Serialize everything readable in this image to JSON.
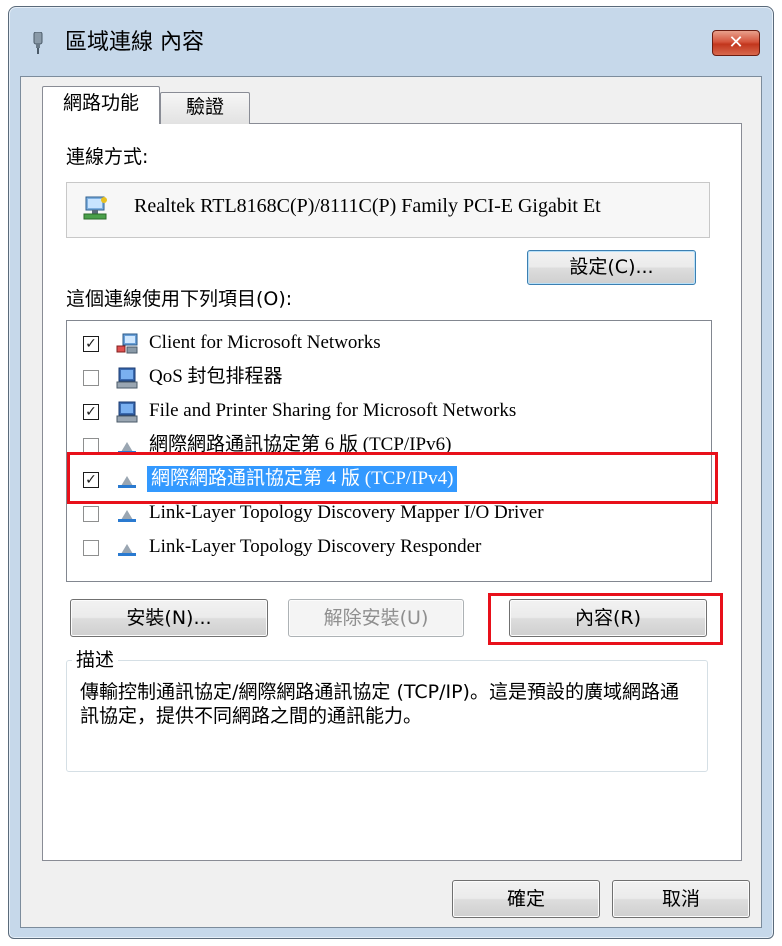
{
  "window": {
    "title": "區域連線 內容",
    "close_glyph": "✕",
    "close_color": "#c2361d"
  },
  "tabs": [
    {
      "label": "網路功能",
      "active": true
    },
    {
      "label": "驗證",
      "active": false
    }
  ],
  "connect_using": {
    "label": "連線方式:",
    "adapter": "Realtek RTL8168C(P)/8111C(P) Family PCI-E Gigabit Et",
    "configure_button": "設定(C)..."
  },
  "items": {
    "label": "這個連線使用下列項目(O):",
    "list": [
      {
        "label": "Client for Microsoft Networks",
        "checked": true,
        "icon": "network-client-icon"
      },
      {
        "label": "QoS 封包排程器",
        "checked": false,
        "icon": "computer-service-icon"
      },
      {
        "label": "File and Printer Sharing for Microsoft Networks",
        "checked": true,
        "icon": "computer-service-icon"
      },
      {
        "label": "網際網路通訊協定第 6 版 (TCP/IPv6)",
        "checked": false,
        "icon": "protocol-icon"
      },
      {
        "label": "網際網路通訊協定第 4 版 (TCP/IPv4)",
        "checked": true,
        "icon": "protocol-icon",
        "selected": true
      },
      {
        "label": "Link-Layer Topology Discovery Mapper I/O Driver",
        "checked": false,
        "icon": "protocol-icon"
      },
      {
        "label": "Link-Layer Topology Discovery Responder",
        "checked": false,
        "icon": "protocol-icon"
      }
    ]
  },
  "buttons": {
    "install": "安裝(N)...",
    "uninstall": "解除安裝(U)",
    "properties": "內容(R)",
    "ok": "確定",
    "cancel": "取消"
  },
  "description": {
    "title": "描述",
    "text": "傳輸控制通訊協定/網際網路通訊協定 (TCP/IP)。這是預設的廣域網路通訊協定，提供不同網路之間的通訊能力。"
  },
  "colors": {
    "selection": "#3399ff",
    "annotation_red": "#e8101a",
    "frame": "#c6d8ea"
  }
}
